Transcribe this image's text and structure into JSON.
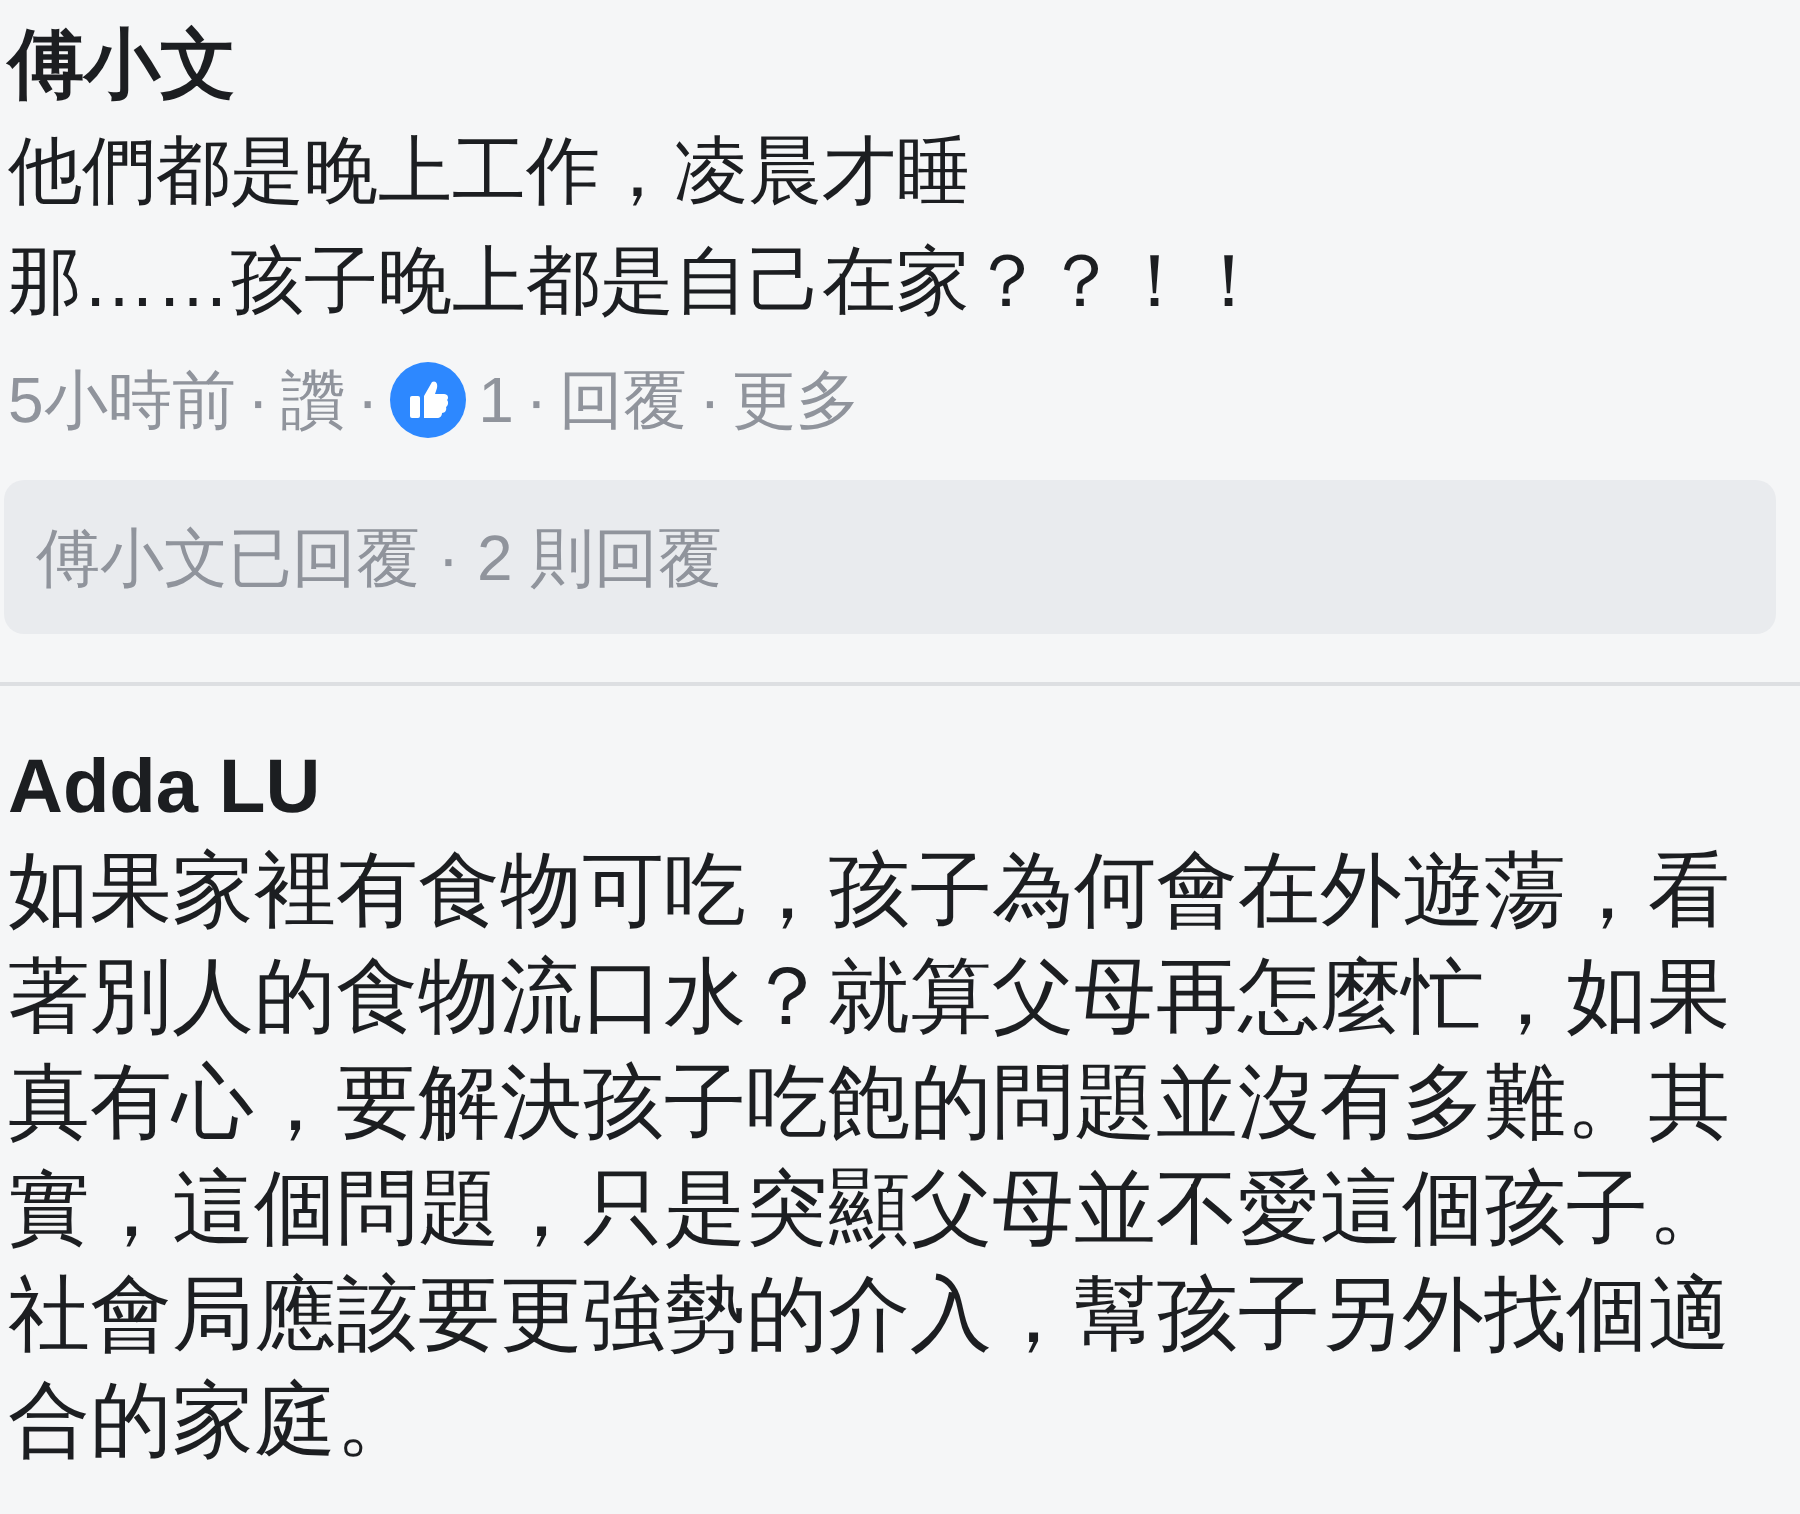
{
  "comments": [
    {
      "author": "傅小文",
      "lines": [
        "他們都是晚上工作，凌晨才睡",
        "那……孩子晚上都是自己在家？？！！"
      ],
      "meta": {
        "time": "5小時前",
        "like": "讚",
        "reaction_count": "1",
        "reply": "回覆",
        "more": "更多",
        "separator": "·"
      },
      "replies_summary": "傅小文已回覆 · 2 則回覆"
    },
    {
      "author": "Adda LU",
      "lines": [
        "如果家裡有食物可吃，孩子為何會在外遊蕩，看著別人的食物流口水？就算父母再怎麼忙，如果真有心，要解決孩子吃飽的問題並沒有多難。其實，這個問題，只是突顯父母並不愛這個孩子。社會局應該要更強勢的介入，幫孩子另外找個適合的家庭。"
      ]
    }
  ]
}
